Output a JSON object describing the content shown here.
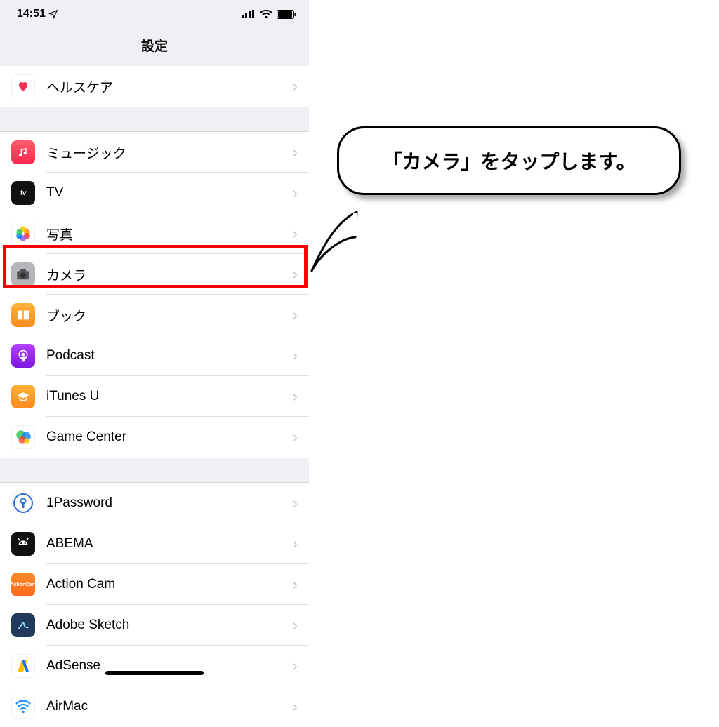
{
  "status": {
    "time": "14:51",
    "location_glyph": "➤",
    "signal_glyph": "•ıll",
    "wifi_glyph": "",
    "battery_glyph": ""
  },
  "nav": {
    "title": "設定"
  },
  "groups": [
    {
      "items": [
        {
          "key": "health",
          "label": "ヘルスケア",
          "icon": "health-icon"
        }
      ]
    },
    {
      "items": [
        {
          "key": "music",
          "label": "ミュージック",
          "icon": "music-icon"
        },
        {
          "key": "tv",
          "label": "TV",
          "icon": "tv-icon",
          "icon_text": "tv"
        },
        {
          "key": "photos",
          "label": "写真",
          "icon": "photos-icon"
        },
        {
          "key": "camera",
          "label": "カメラ",
          "icon": "camera-icon",
          "highlighted": true
        },
        {
          "key": "books",
          "label": "ブック",
          "icon": "books-icon"
        },
        {
          "key": "podcast",
          "label": "Podcast",
          "icon": "podcast-icon"
        },
        {
          "key": "itunesu",
          "label": "iTunes U",
          "icon": "itunesu-icon"
        },
        {
          "key": "gamecenter",
          "label": "Game Center",
          "icon": "gamecenter-icon"
        }
      ]
    },
    {
      "items": [
        {
          "key": "1password",
          "label": "1Password",
          "icon": "1password-icon",
          "icon_text": "◐"
        },
        {
          "key": "abema",
          "label": "ABEMA",
          "icon": "abema-icon"
        },
        {
          "key": "actioncam",
          "label": "Action Cam",
          "icon": "actioncam-icon",
          "icon_text": "ActionCam"
        },
        {
          "key": "adobesketch",
          "label": "Adobe Sketch",
          "icon": "adobesketch-icon"
        },
        {
          "key": "adsense",
          "label": "AdSense",
          "icon": "adsense-icon"
        },
        {
          "key": "airmac",
          "label": "AirMac",
          "icon": "airmac-icon"
        }
      ]
    }
  ],
  "callout": {
    "text": "「カメラ」をタップします。"
  }
}
